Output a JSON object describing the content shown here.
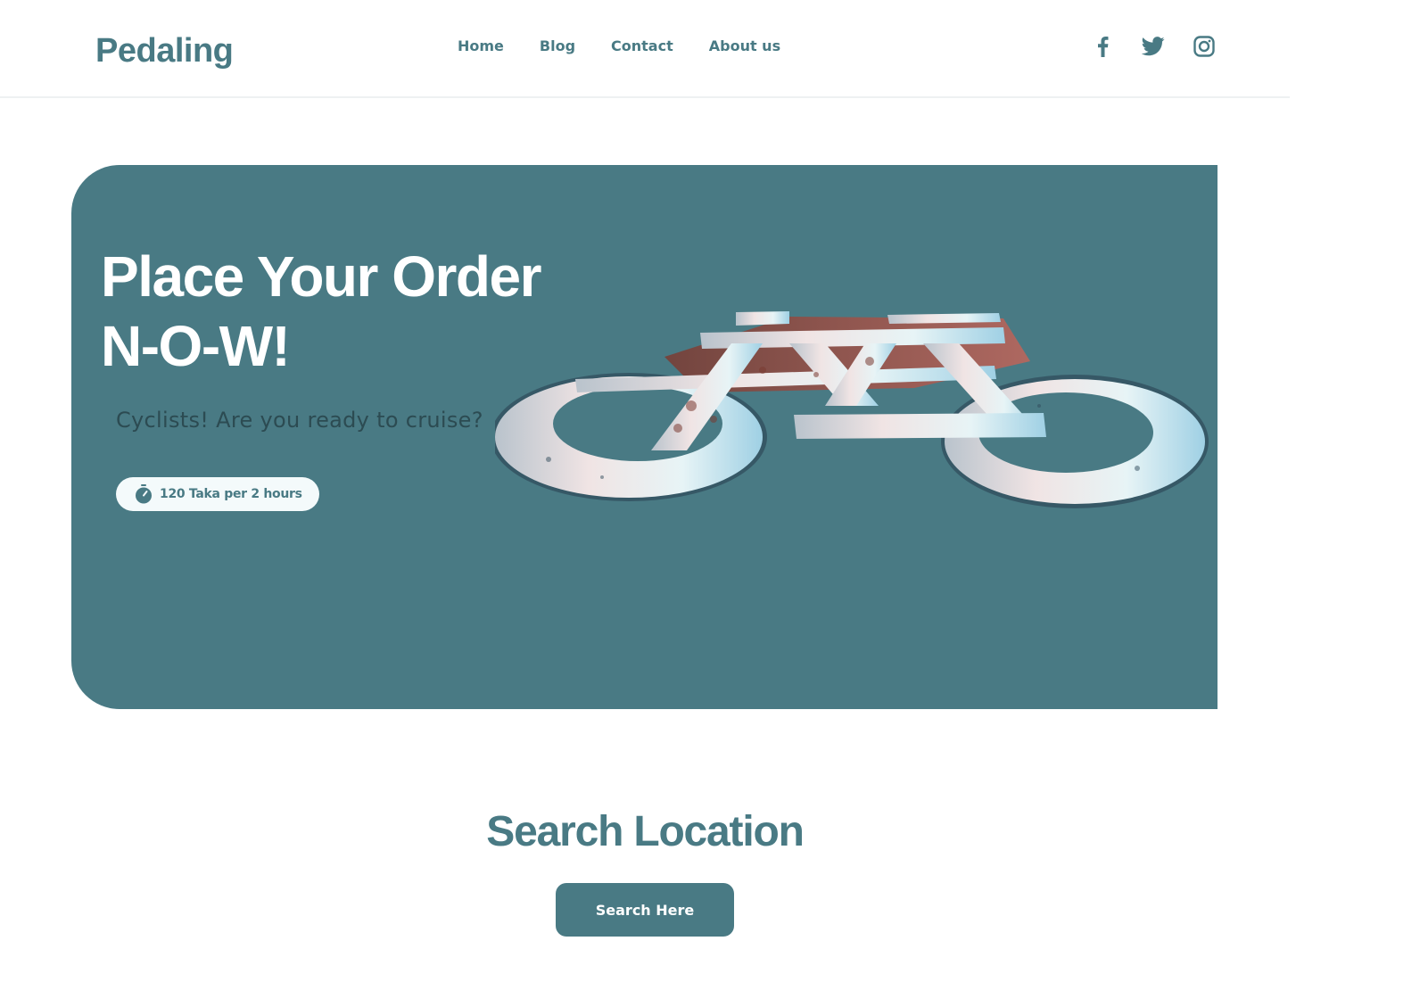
{
  "header": {
    "logo": "Pedaling",
    "nav": [
      "Home",
      "Blog",
      "Contact",
      "About us"
    ],
    "social": [
      "facebook-icon",
      "twitter-icon",
      "instagram-icon"
    ]
  },
  "hero": {
    "title_line1": "Place Your Order",
    "title_line2": "N-O-W!",
    "subtitle": "Cyclists! Are you ready to cruise?",
    "price_label": "120 Taka per 2 hours",
    "price_icon": "stopwatch-icon",
    "image": "bicycle-road-marking"
  },
  "search": {
    "title": "Search Location",
    "button_label": "Search Here"
  },
  "colors": {
    "brand": "#497a84",
    "hero_bg": "#497a84",
    "pill_bg": "#f4fafb",
    "subtitle": "#2c4b52"
  }
}
